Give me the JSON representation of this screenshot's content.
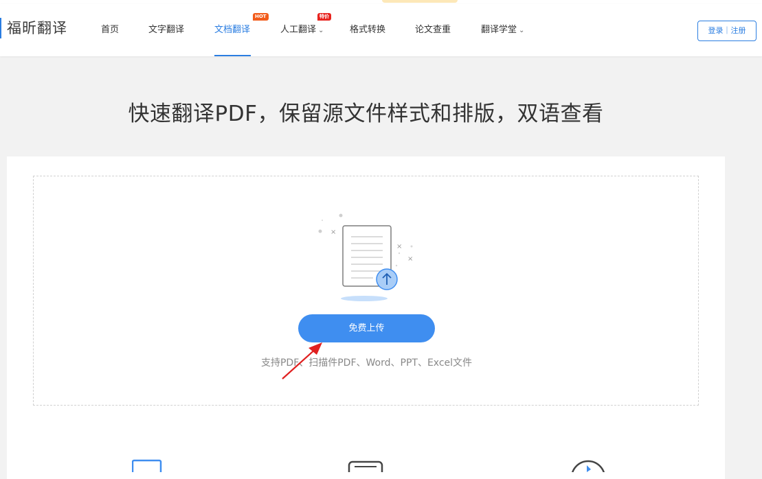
{
  "header": {
    "logo_text": "福昕翻译",
    "nav": [
      {
        "label": "首页"
      },
      {
        "label": "文字翻译"
      },
      {
        "label": "文档翻译",
        "badge": "HOT",
        "active": true
      },
      {
        "label": "人工翻译",
        "badge": "特价",
        "has_dropdown": true
      },
      {
        "label": "格式转换"
      },
      {
        "label": "论文查重"
      },
      {
        "label": "翻译学堂",
        "has_dropdown": true
      }
    ],
    "login_label": "登录｜注册"
  },
  "main": {
    "title": "快速翻译PDF，保留源文件样式和排版，双语查看",
    "upload_button": "免费上传",
    "support_text": "支持PDF、扫描件PDF、Word、PPT、Excel文件"
  },
  "colors": {
    "accent": "#2a7de1",
    "button": "#3f8ef0",
    "hot_badge": "#f25c1b",
    "special_badge": "#e8231e",
    "annotation_arrow": "#e02020"
  },
  "icons": [
    "upload-document-icon",
    "arrow-up-icon",
    "feature-monitor-icon",
    "feature-document-icon",
    "feature-clock-icon",
    "annotation-arrow"
  ]
}
